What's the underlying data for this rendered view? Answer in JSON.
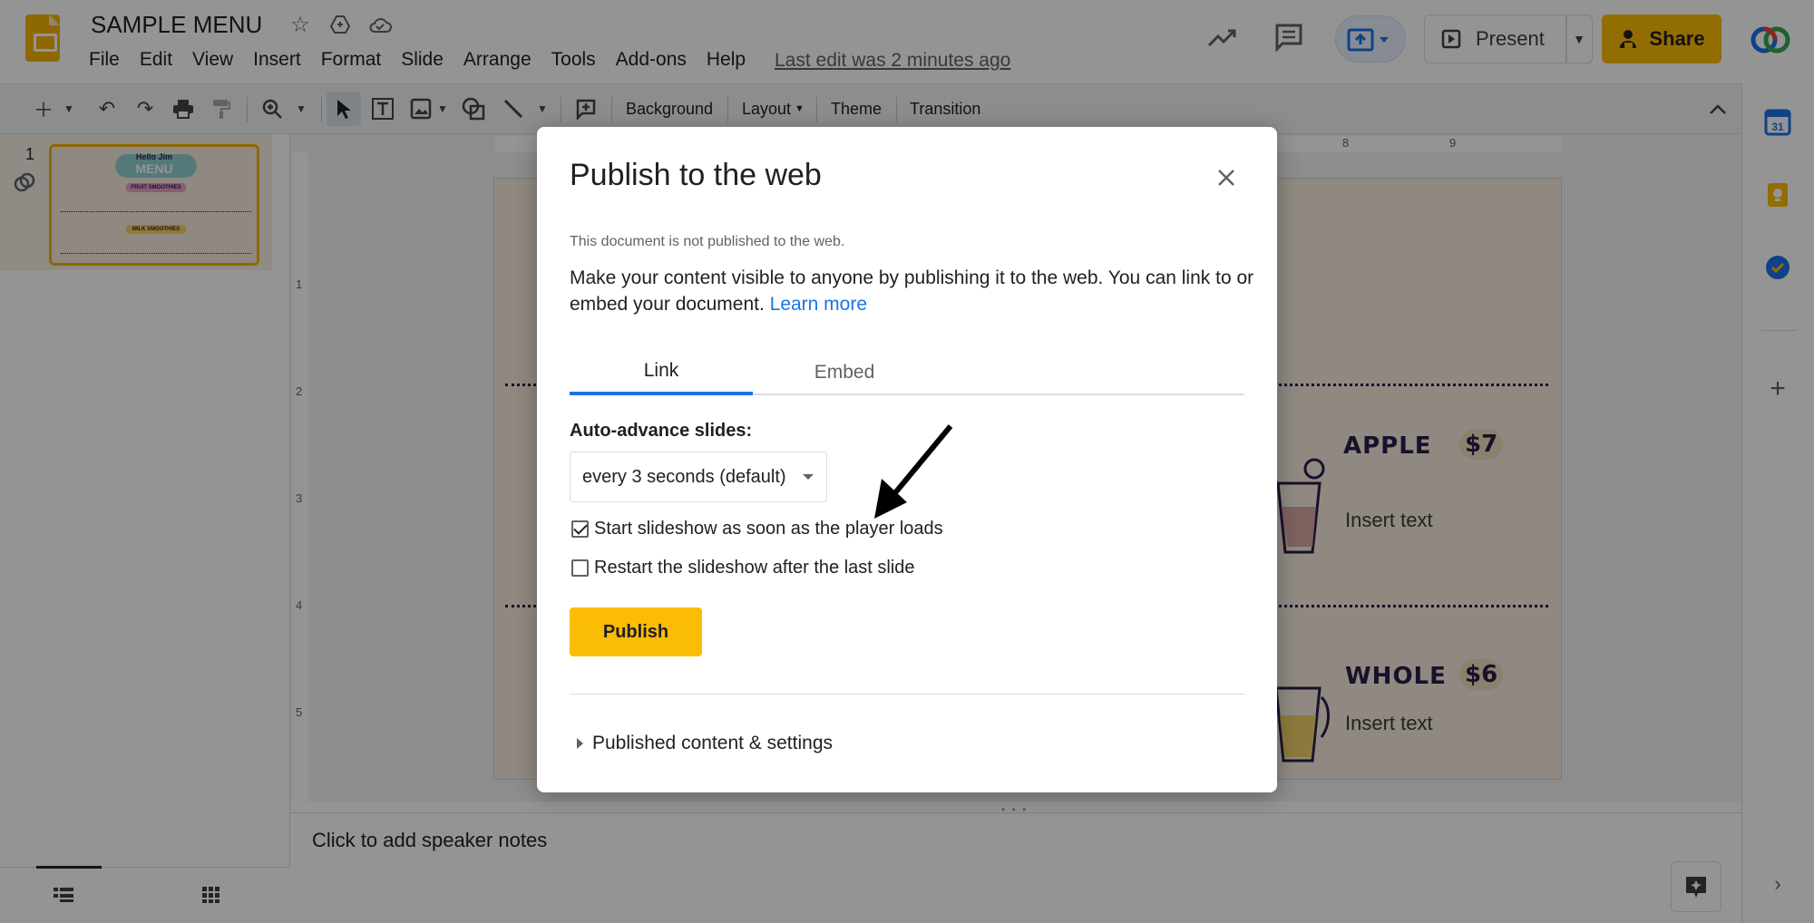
{
  "app": {
    "doc_title": "SAMPLE MENU",
    "last_edit": "Last edit was 2 minutes ago",
    "menus": [
      "File",
      "Edit",
      "View",
      "Insert",
      "Format",
      "Slide",
      "Arrange",
      "Tools",
      "Add-ons",
      "Help"
    ],
    "present_label": "Present",
    "share_label": "Share"
  },
  "toolbar": {
    "background_label": "Background",
    "layout_label": "Layout",
    "theme_label": "Theme",
    "transition_label": "Transition"
  },
  "filmstrip": {
    "slide_number": "1"
  },
  "ruler": {
    "h_marks": [
      "8",
      "9"
    ],
    "v_marks": [
      "1",
      "2",
      "3",
      "4",
      "5"
    ]
  },
  "slide": {
    "items": [
      {
        "name": "APPLE",
        "price": "$7",
        "text": "Insert text"
      },
      {
        "name": "WHOLE",
        "price": "$6",
        "text": "Insert text"
      }
    ],
    "thumb_title_top": "Hello Jim",
    "thumb_title": "MENU",
    "thumb_fruit": "FRUIT SMOOTHIES",
    "thumb_milk": "MILK SMOOTHIES"
  },
  "notes": {
    "placeholder": "Click to add speaker notes"
  },
  "dialog": {
    "title": "Publish to the web",
    "status": "This document is not published to the web.",
    "description": "Make your content visible to anyone by publishing it to the web. You can link to or embed your document.",
    "learn_more": "Learn more",
    "tabs": [
      "Link",
      "Embed"
    ],
    "active_tab": "Link",
    "auto_advance_label": "Auto-advance slides:",
    "auto_advance_value": "every 3 seconds (default)",
    "option_start": {
      "label": "Start slideshow as soon as the player loads",
      "checked": true
    },
    "option_restart": {
      "label": "Restart the slideshow after the last slide",
      "checked": false
    },
    "publish_label": "Publish",
    "published_settings_label": "Published content & settings"
  },
  "colors": {
    "accent_yellow": "#fbbc04",
    "link_blue": "#1a73e8",
    "slide_bg": "#f6ecdf"
  }
}
